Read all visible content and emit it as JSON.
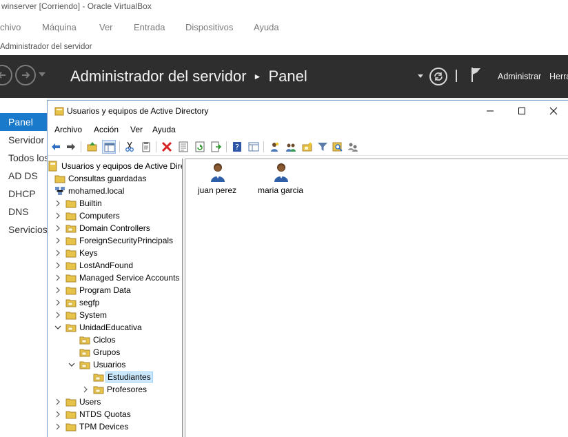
{
  "vbox": {
    "title": "winserver [Corriendo] - Oracle VirtualBox",
    "menu": [
      "chivo",
      "Máquina",
      "Ver",
      "Entrada",
      "Dispositivos",
      "Ayuda"
    ]
  },
  "vm_window_title": "Administrador del servidor",
  "server_manager": {
    "title": "Administrador del servidor",
    "section": "Panel",
    "menu": [
      "Administrar",
      "Herra"
    ],
    "sidebar": [
      {
        "label": "Panel",
        "active": true
      },
      {
        "label": "Servidor",
        "active": false
      },
      {
        "label": "Todos los",
        "active": false
      },
      {
        "label": "AD DS",
        "active": false
      },
      {
        "label": "DHCP",
        "active": false
      },
      {
        "label": "DNS",
        "active": false
      },
      {
        "label": "Servicios",
        "active": false
      }
    ],
    "accent_color": "#1979ca",
    "header_color": "#2e2e2e"
  },
  "aduc": {
    "title": "Usuarios y equipos de Active Directory",
    "menu": [
      "Archivo",
      "Acción",
      "Ver",
      "Ayuda"
    ],
    "toolbar_icons": [
      "back-arrow-icon",
      "forward-arrow-icon",
      "up-folder-icon",
      "show-hide-tree-icon",
      "cut-icon",
      "clipboard-icon",
      "delete-icon",
      "properties-icon",
      "refresh-icon",
      "export-list-icon",
      "help-icon",
      "details-view-icon",
      "new-user-icon",
      "new-group-icon",
      "new-ou-icon",
      "filter-icon",
      "find-icon",
      "add-to-group-icon"
    ],
    "tree": [
      {
        "label": "Usuarios y equipos de Active Direct",
        "icon": "aduc",
        "level": 0,
        "expander": "none",
        "selected": false
      },
      {
        "label": "Consultas guardadas",
        "icon": "folder",
        "level": 1,
        "expander": "none",
        "selected": false
      },
      {
        "label": "mohamed.local",
        "icon": "domain",
        "level": 1,
        "expander": "none",
        "selected": false
      },
      {
        "label": "Builtin",
        "icon": "folder",
        "level": 2,
        "expander": "collapsed",
        "selected": false
      },
      {
        "label": "Computers",
        "icon": "folder",
        "level": 2,
        "expander": "collapsed",
        "selected": false
      },
      {
        "label": "Domain Controllers",
        "icon": "ou",
        "level": 2,
        "expander": "collapsed",
        "selected": false
      },
      {
        "label": "ForeignSecurityPrincipals",
        "icon": "folder",
        "level": 2,
        "expander": "collapsed",
        "selected": false
      },
      {
        "label": "Keys",
        "icon": "folder",
        "level": 2,
        "expander": "collapsed",
        "selected": false
      },
      {
        "label": "LostAndFound",
        "icon": "folder",
        "level": 2,
        "expander": "collapsed",
        "selected": false
      },
      {
        "label": "Managed Service Accounts",
        "icon": "folder",
        "level": 2,
        "expander": "collapsed",
        "selected": false
      },
      {
        "label": "Program Data",
        "icon": "folder",
        "level": 2,
        "expander": "collapsed",
        "selected": false
      },
      {
        "label": "segfp",
        "icon": "ou",
        "level": 2,
        "expander": "collapsed",
        "selected": false
      },
      {
        "label": "System",
        "icon": "folder",
        "level": 2,
        "expander": "collapsed",
        "selected": false
      },
      {
        "label": "UnidadEducativa",
        "icon": "ou",
        "level": 2,
        "expander": "expanded",
        "selected": false
      },
      {
        "label": "Ciclos",
        "icon": "ou",
        "level": 3,
        "expander": "none",
        "selected": false
      },
      {
        "label": "Grupos",
        "icon": "ou",
        "level": 3,
        "expander": "none",
        "selected": false
      },
      {
        "label": "Usuarios",
        "icon": "ou",
        "level": 3,
        "expander": "expanded",
        "selected": false
      },
      {
        "label": "Estudiantes",
        "icon": "ou",
        "level": 4,
        "expander": "none",
        "selected": true
      },
      {
        "label": "Profesores",
        "icon": "ou",
        "level": 4,
        "expander": "collapsed",
        "selected": false
      },
      {
        "label": "Users",
        "icon": "folder",
        "level": 2,
        "expander": "collapsed",
        "selected": false
      },
      {
        "label": "NTDS Quotas",
        "icon": "folder",
        "level": 2,
        "expander": "collapsed",
        "selected": false
      },
      {
        "label": "TPM Devices",
        "icon": "folder",
        "level": 2,
        "expander": "collapsed",
        "selected": false
      }
    ],
    "users": [
      {
        "name": "juan perez"
      },
      {
        "name": "maria garcia"
      }
    ]
  }
}
